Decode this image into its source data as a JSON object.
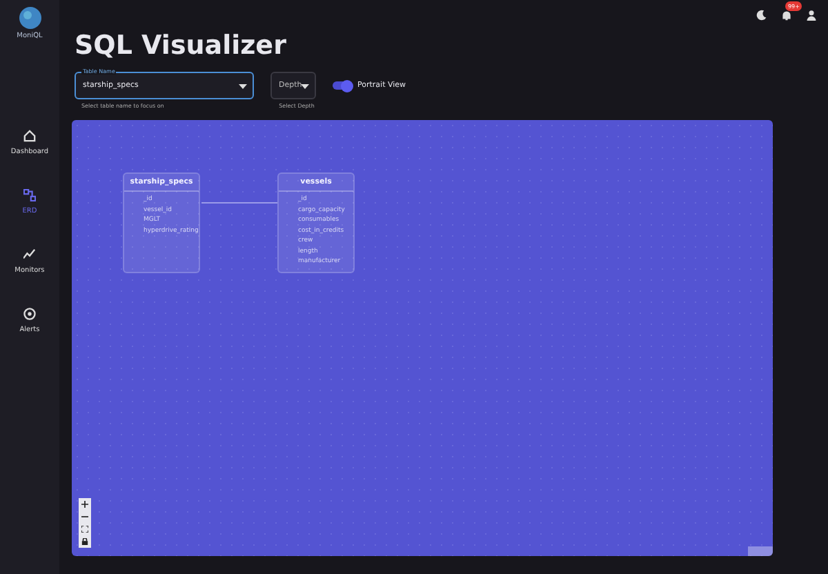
{
  "sidebar": {
    "logo": "MoniQL",
    "items": [
      {
        "label": "Dashboard",
        "selected": false
      },
      {
        "label": "ERD",
        "selected": true
      },
      {
        "label": "Monitors",
        "selected": false
      },
      {
        "label": "Alerts",
        "selected": false
      }
    ]
  },
  "header": {
    "notification_count": "99+"
  },
  "title": "SQL Visualizer",
  "table_select": {
    "label": "Table Name",
    "value": "starship_specs",
    "helper": "Select table name to focus on"
  },
  "depth_select": {
    "placeholder": "Depth",
    "helper": "Select Depth"
  },
  "portrait_toggle": {
    "label": "Portrait View",
    "on": true
  },
  "diagram": {
    "nodes": [
      {
        "name": "starship_specs",
        "fields": [
          "_id",
          "vessel_id",
          "MGLT",
          "hyperdrive_rating"
        ]
      },
      {
        "name": "vessels",
        "fields": [
          "_id",
          "cargo_capacity",
          "consumables",
          "cost_in_credits",
          "crew",
          "length",
          "manufacturer"
        ]
      }
    ]
  }
}
